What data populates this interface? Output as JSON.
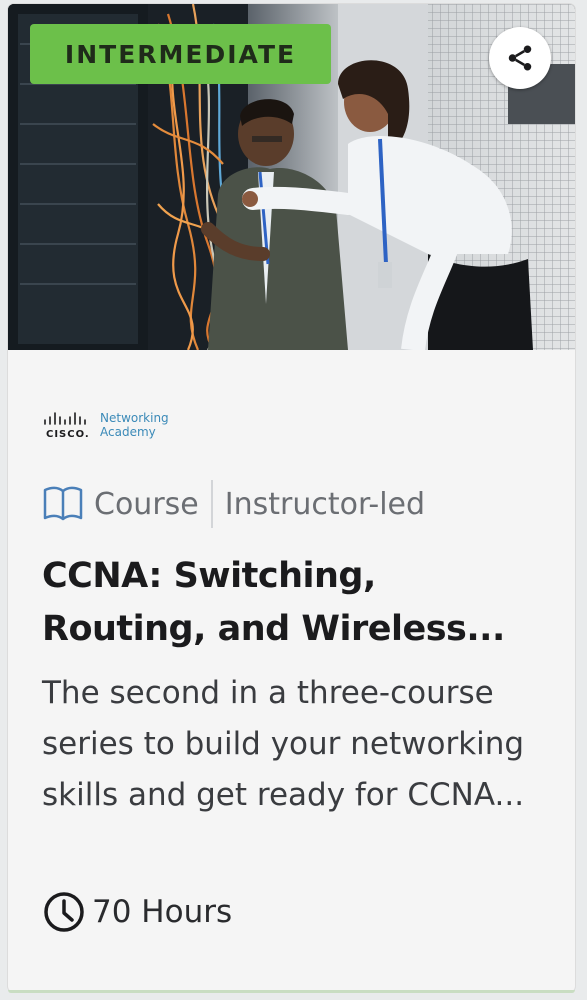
{
  "card": {
    "level_badge": "INTERMEDIATE",
    "share_icon": "share-icon",
    "hero_image_alt": "Two network technicians working on cabling in a server room",
    "provider": {
      "logo_word": "CISCO.",
      "name_line1": "Networking",
      "name_line2": "Academy"
    },
    "type_icon": "book-icon",
    "type_label": "Course",
    "delivery_label": "Instructor-led",
    "title_line1": "CCNA: Switching,",
    "title_line2": "Routing, and Wireless...",
    "description_line1": "The second in a three-course",
    "description_line2": "series to build your networking",
    "description_line3": "skills and get ready for CCNA...",
    "duration_icon": "clock-icon",
    "duration_label": "70 Hours"
  },
  "colors": {
    "badge_green": "#6cc04a",
    "card_background": "#f5f5f5",
    "cisco_blue": "#3b8ab8"
  }
}
